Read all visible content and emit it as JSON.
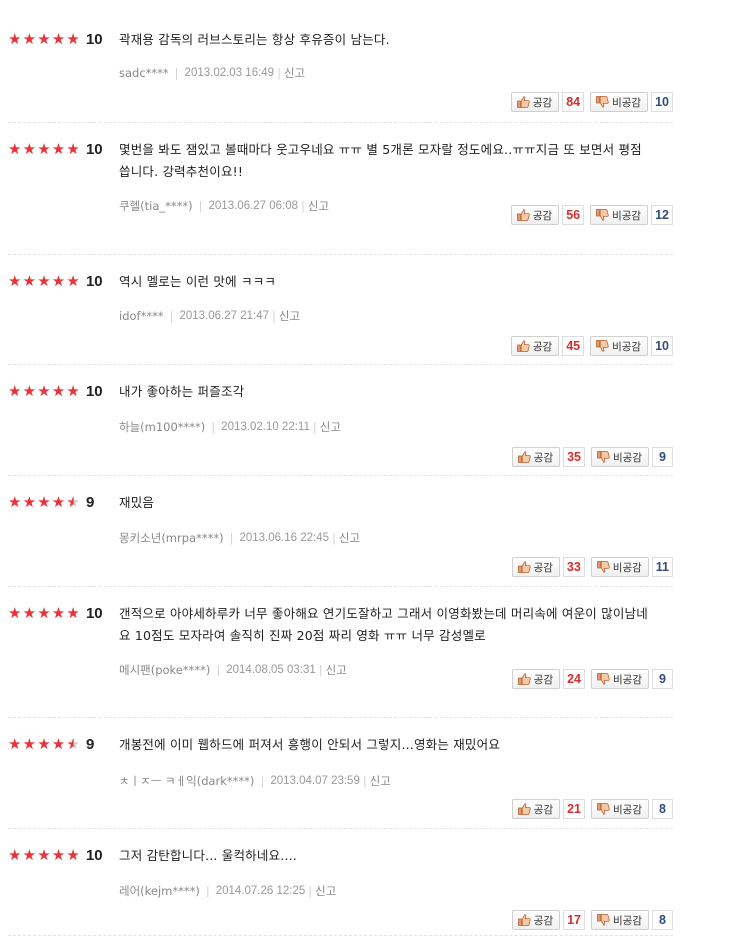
{
  "labels": {
    "like": "공감",
    "dislike": "비공감",
    "report": "신고"
  },
  "colors": {
    "star": "#e8333a",
    "like_count": "#d62e2e",
    "dislike_count": "#334c80"
  },
  "reviews": [
    {
      "rating": 5,
      "score": "10",
      "text": "곽재용 감독의 러브스토리는 항상 후유증이 남는다.",
      "user": "sadc****",
      "date": "2013.02.03 16:49",
      "likes": "84",
      "dislikes": "10"
    },
    {
      "rating": 5,
      "score": "10",
      "text": "몇번을 봐도 잼있고 볼때마다 웃고우네요 ㅠㅠ 별 5개론 모자랄 정도에요..ㅠㅠ지금 또 보면서 평점 씁니다. 강력추천이요!!",
      "user": "쿠헬(tia_****)",
      "date": "2013.06.27 06:08",
      "likes": "56",
      "dislikes": "12"
    },
    {
      "rating": 5,
      "score": "10",
      "text": "역시 멜로는 이런 맛에 ㅋㅋㅋ",
      "user": "idof****",
      "date": "2013.06.27 21:47",
      "likes": "45",
      "dislikes": "10"
    },
    {
      "rating": 5,
      "score": "10",
      "text": "내가 좋아하는 퍼즐조각",
      "user": "하늘(m100****)",
      "date": "2013.02.10 22:11",
      "likes": "35",
      "dislikes": "9"
    },
    {
      "rating": 4.5,
      "score": "9",
      "text": "재밌음",
      "user": "몽키소년(mrpa****)",
      "date": "2013.06.16 22:45",
      "likes": "33",
      "dislikes": "11"
    },
    {
      "rating": 5,
      "score": "10",
      "text": "갠적으로 아야세하루카 너무 좋아해요 연기도잘하고 그래서 이영화봤는데 머리속에 여운이 많이남네요 10점도 모자라여 솔직히 진짜 20점 짜리 영화 ㅠㅠ 너무 감성멜로",
      "user": "메시팬(poke****)",
      "date": "2014.08.05 03:31",
      "likes": "24",
      "dislikes": "9"
    },
    {
      "rating": 4.5,
      "score": "9",
      "text": "개봉전에 이미 웹하드에 퍼져서 흥행이 안되서 그렇지...영화는 재밌어요",
      "user": "ㅊㅣㅈㅡ ㅋㅔ익(dark****)",
      "date": "2013.04.07 23:59",
      "likes": "21",
      "dislikes": "8"
    },
    {
      "rating": 5,
      "score": "10",
      "text": "그저 감탄합니다... 울컥하네요....",
      "user": "레어(kejm****)",
      "date": "2014.07.26 12:25",
      "likes": "17",
      "dislikes": "8"
    }
  ]
}
